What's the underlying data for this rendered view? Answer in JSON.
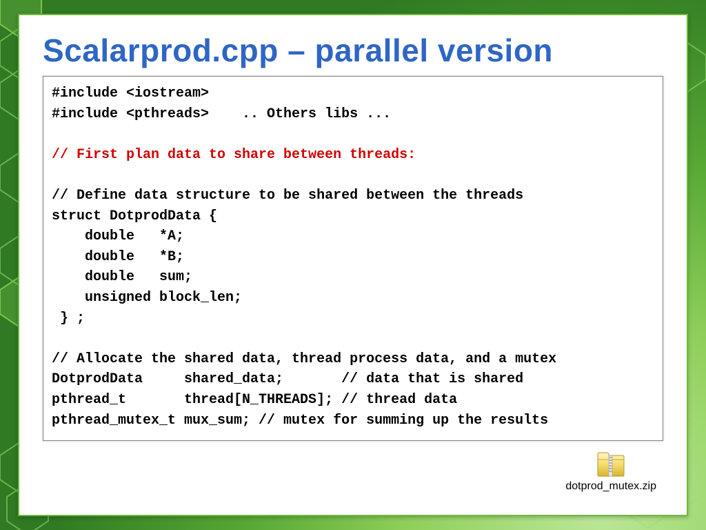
{
  "slide": {
    "title": "Scalarprod.cpp – parallel version"
  },
  "code": {
    "line1": "#include <iostream>",
    "line2": "#include <pthreads>    .. Others libs ...",
    "blank1": "",
    "comment_red": "// First plan data to share between threads:",
    "blank2": "",
    "cdef1": "// Define data structure to be shared between the threads",
    "cdef2": "struct DotprodData {",
    "cdef3": "    double   *A;",
    "cdef4": "    double   *B;",
    "cdef5": "    double   sum;",
    "cdef6": "    unsigned block_len;",
    "cdef7": " } ;",
    "blank3": "",
    "alloc1": "// Allocate the shared data, thread process data, and a mutex",
    "alloc2": "DotprodData     shared_data;       // data that is shared",
    "alloc3": "pthread_t       thread[N_THREADS]; // thread data",
    "alloc4": "pthread_mutex_t mux_sum; // mutex for summing up the results"
  },
  "attachment": {
    "icon": "zip-folder-icon",
    "filename": "dotprod_mutex.zip"
  },
  "colors": {
    "title": "#2f66c4",
    "comment_highlight": "#d40000",
    "frame": "#6dba3b"
  }
}
